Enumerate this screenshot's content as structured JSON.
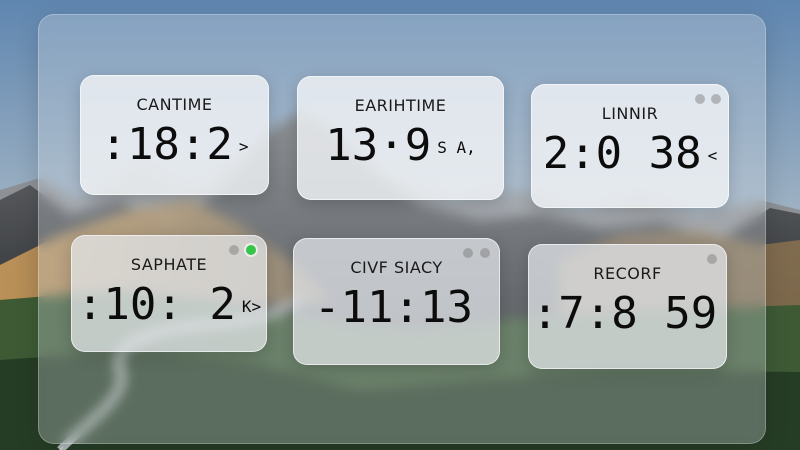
{
  "colors": {
    "sky_top": "#5f86b0",
    "sky_bottom": "#c8d2d8",
    "mountain_dark": "#3b3e42",
    "hill_gold": "#b08e5e",
    "forest": "#2f4a2c",
    "widget_bg": "#eff2f4",
    "close_active": "#37c44a"
  },
  "widgets": [
    {
      "title": "CANTIME",
      "time": ":18:2",
      "suffix": ">",
      "controls": []
    },
    {
      "title": "EARIHTIME",
      "time": "13·9",
      "suffix": "S A,",
      "controls": []
    },
    {
      "title": "LINNIR",
      "time": "2:0 38",
      "suffix": "<",
      "controls": [
        "minimize-icon",
        "close-icon"
      ]
    },
    {
      "title": "SAPHATE",
      "time": ":10: 2",
      "suffix": "K>",
      "controls": [
        "minimize-icon",
        "green-dot-icon"
      ]
    },
    {
      "title": "CIVF SIACY",
      "time": "-11:13",
      "suffix": "",
      "controls": [
        "minimize-icon",
        "close-icon"
      ]
    },
    {
      "title": "RECORF",
      "time": ":7:8 59",
      "suffix": "",
      "controls": [
        "close-icon"
      ]
    }
  ]
}
